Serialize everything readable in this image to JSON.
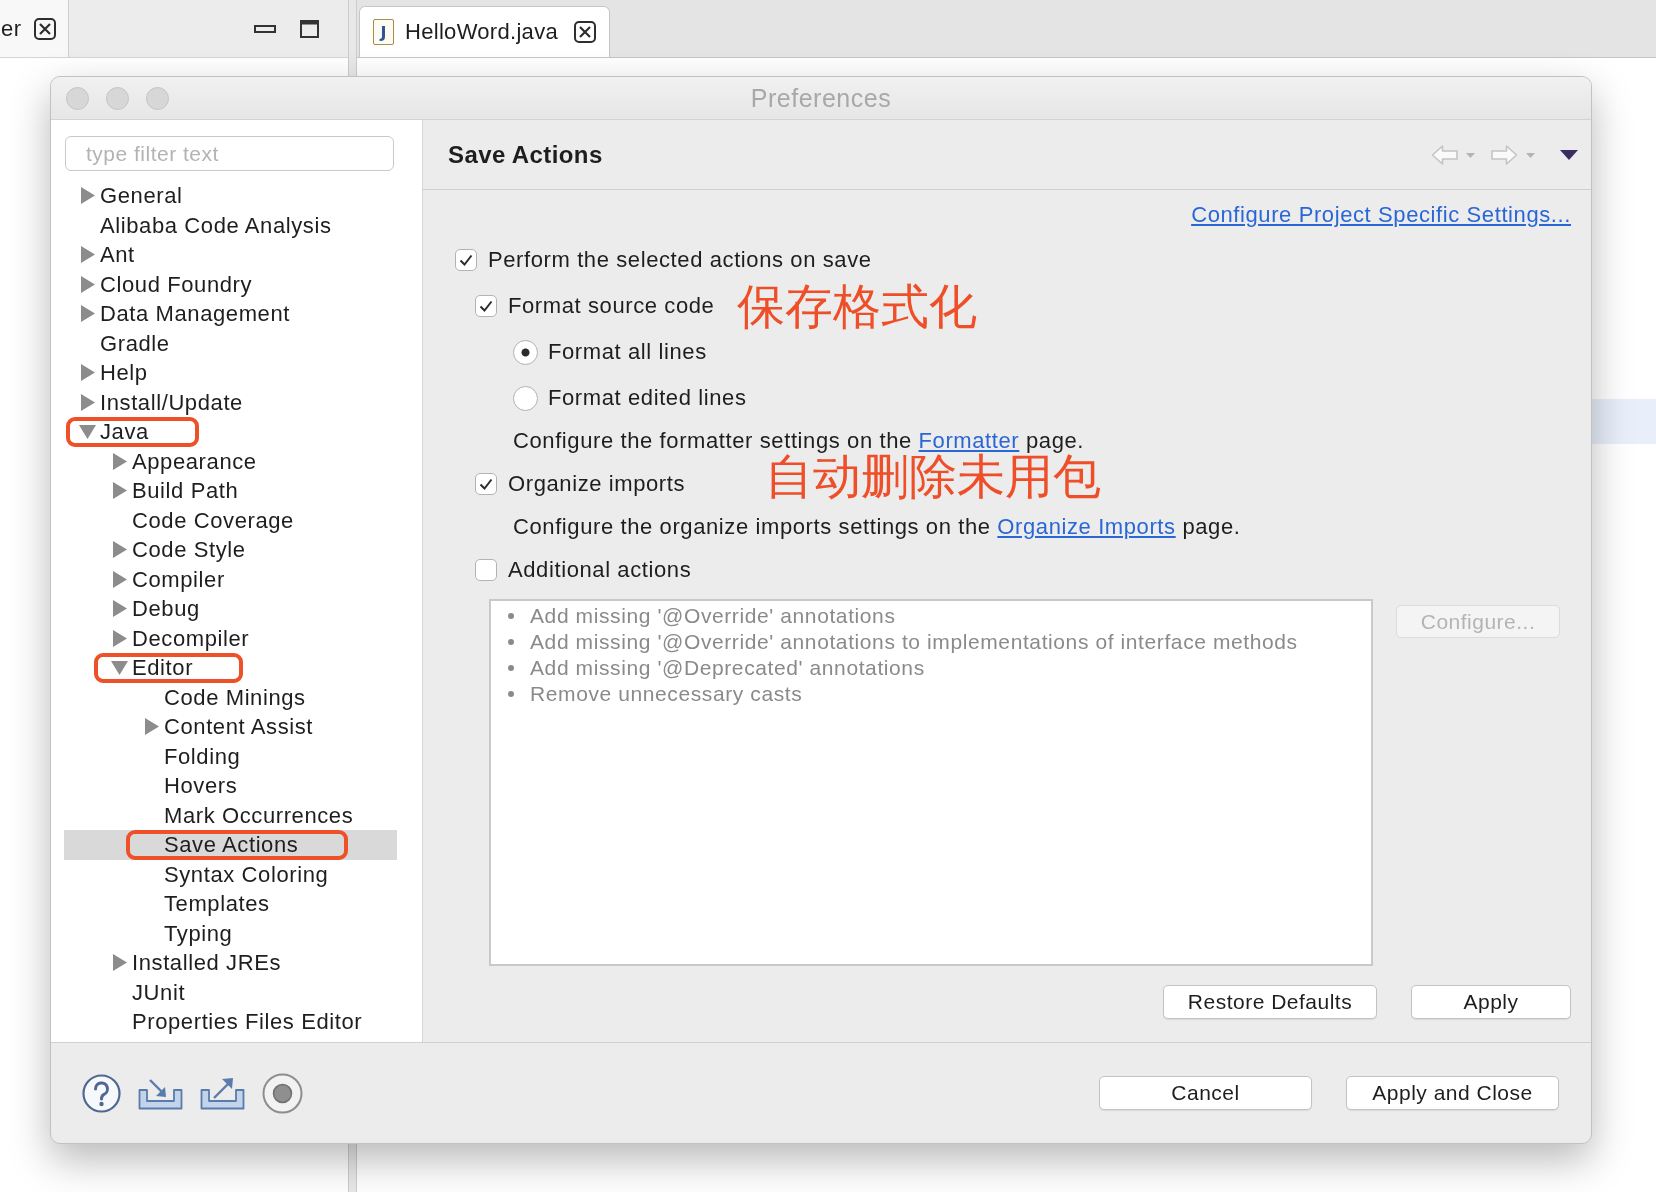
{
  "ide": {
    "side_tab": {
      "label": "er"
    },
    "editor_tab": {
      "icon_glyph": "J",
      "label": "HelloWord.java"
    }
  },
  "dialog": {
    "title": "Preferences"
  },
  "filter": {
    "placeholder": "type filter text"
  },
  "tree": [
    {
      "label": "General",
      "expandable": true,
      "expanded": false,
      "selected": false,
      "highlighted": false
    },
    {
      "label": "Alibaba Code Analysis",
      "expandable": false,
      "expanded": false,
      "selected": false,
      "highlighted": false
    },
    {
      "label": "Ant",
      "expandable": true,
      "expanded": false,
      "selected": false,
      "highlighted": false
    },
    {
      "label": "Cloud Foundry",
      "expandable": true,
      "expanded": false,
      "selected": false,
      "highlighted": false
    },
    {
      "label": "Data Management",
      "expandable": true,
      "expanded": false,
      "selected": false,
      "highlighted": false
    },
    {
      "label": "Gradle",
      "expandable": false,
      "expanded": false,
      "selected": false,
      "highlighted": false
    },
    {
      "label": "Help",
      "expandable": true,
      "expanded": false,
      "selected": false,
      "highlighted": false
    },
    {
      "label": "Install/Update",
      "expandable": true,
      "expanded": false,
      "selected": false,
      "highlighted": false
    },
    {
      "label": "Java",
      "expandable": true,
      "expanded": true,
      "selected": false,
      "highlighted": true,
      "children": [
        {
          "label": "Appearance",
          "expandable": true,
          "expanded": false,
          "selected": false,
          "highlighted": false
        },
        {
          "label": "Build Path",
          "expandable": true,
          "expanded": false,
          "selected": false,
          "highlighted": false
        },
        {
          "label": "Code Coverage",
          "expandable": false,
          "expanded": false,
          "selected": false,
          "highlighted": false
        },
        {
          "label": "Code Style",
          "expandable": true,
          "expanded": false,
          "selected": false,
          "highlighted": false
        },
        {
          "label": "Compiler",
          "expandable": true,
          "expanded": false,
          "selected": false,
          "highlighted": false
        },
        {
          "label": "Debug",
          "expandable": true,
          "expanded": false,
          "selected": false,
          "highlighted": false
        },
        {
          "label": "Decompiler",
          "expandable": true,
          "expanded": false,
          "selected": false,
          "highlighted": false
        },
        {
          "label": "Editor",
          "expandable": true,
          "expanded": true,
          "selected": false,
          "highlighted": true,
          "children": [
            {
              "label": "Code Minings",
              "expandable": false,
              "expanded": false,
              "selected": false,
              "highlighted": false
            },
            {
              "label": "Content Assist",
              "expandable": true,
              "expanded": false,
              "selected": false,
              "highlighted": false
            },
            {
              "label": "Folding",
              "expandable": false,
              "expanded": false,
              "selected": false,
              "highlighted": false
            },
            {
              "label": "Hovers",
              "expandable": false,
              "expanded": false,
              "selected": false,
              "highlighted": false
            },
            {
              "label": "Mark Occurrences",
              "expandable": false,
              "expanded": false,
              "selected": false,
              "highlighted": false
            },
            {
              "label": "Save Actions",
              "expandable": false,
              "expanded": false,
              "selected": true,
              "highlighted": true
            },
            {
              "label": "Syntax Coloring",
              "expandable": false,
              "expanded": false,
              "selected": false,
              "highlighted": false
            },
            {
              "label": "Templates",
              "expandable": false,
              "expanded": false,
              "selected": false,
              "highlighted": false
            },
            {
              "label": "Typing",
              "expandable": false,
              "expanded": false,
              "selected": false,
              "highlighted": false
            }
          ]
        },
        {
          "label": "Installed JREs",
          "expandable": true,
          "expanded": false,
          "selected": false,
          "highlighted": false
        },
        {
          "label": "JUnit",
          "expandable": false,
          "expanded": false,
          "selected": false,
          "highlighted": false
        },
        {
          "label": "Properties Files Editor",
          "expandable": false,
          "expanded": false,
          "selected": false,
          "highlighted": false
        }
      ]
    }
  ],
  "page": {
    "title": "Save Actions",
    "project_link": "Configure Project Specific Settings...",
    "options": [
      {
        "kind": "checkbox",
        "label": "Perform the selected actions on save",
        "checked": true,
        "children": [
          {
            "kind": "checkbox",
            "label": "Format source code",
            "checked": true,
            "annotation": "保存格式化",
            "children": [
              {
                "kind": "radio",
                "label": "Format all lines",
                "selected": true
              },
              {
                "kind": "radio",
                "label": "Format edited lines",
                "selected": false
              },
              {
                "kind": "note",
                "before": "Configure the formatter settings on the ",
                "link": "Formatter",
                "after": " page."
              }
            ]
          },
          {
            "kind": "checkbox",
            "label": "Organize imports",
            "checked": true,
            "annotation": "自动删除未用包",
            "children": [
              {
                "kind": "note",
                "before": "Configure the organize imports settings on the ",
                "link": "Organize Imports",
                "after": " page."
              }
            ]
          },
          {
            "kind": "checkbox",
            "label": "Additional actions",
            "checked": false,
            "actions": [
              "Add missing '@Override' annotations",
              "Add missing '@Override' annotations to implementations of interface methods",
              "Add missing '@Deprecated' annotations",
              "Remove unnecessary casts"
            ],
            "configure_button": {
              "label": "Configure...",
              "disabled": true
            }
          }
        ]
      }
    ],
    "buttons": [
      "Restore Defaults",
      "Apply"
    ]
  },
  "footer": {
    "buttons": [
      "Cancel",
      "Apply and Close"
    ]
  }
}
